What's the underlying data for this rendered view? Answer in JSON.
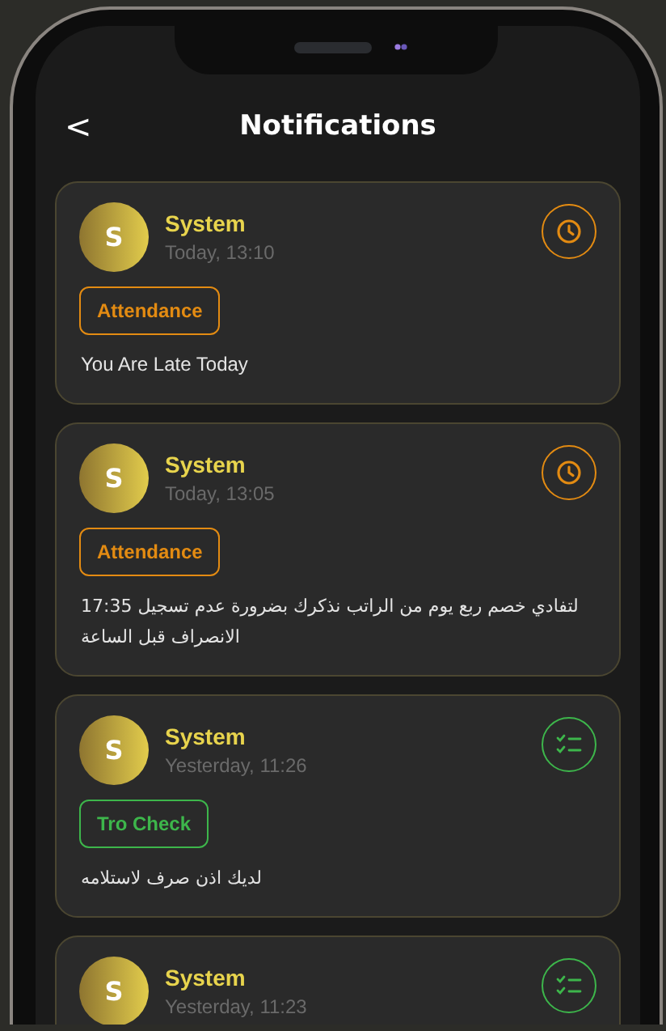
{
  "header": {
    "back": "<",
    "title": "Notifications"
  },
  "notifications": [
    {
      "avatar": "S",
      "sender": "System",
      "time": "Today, 13:10",
      "kind": "attendance",
      "tag": "Attendance",
      "message": "You Are Late Today",
      "rtl": false
    },
    {
      "avatar": "S",
      "sender": "System",
      "time": "Today, 13:05",
      "kind": "attendance",
      "tag": "Attendance",
      "message": "لتفادي خصم ربع يوم من الراتب  نذكرك بضرورة عدم تسجيل 17:35 الانصراف قبل الساعة",
      "rtl": true
    },
    {
      "avatar": "S",
      "sender": "System",
      "time": "Yesterday, 11:26",
      "kind": "tro-check",
      "tag": "Tro Check",
      "message": "لديك اذن صرف لاستلامه",
      "rtl": true
    },
    {
      "avatar": "S",
      "sender": "System",
      "time": "Yesterday, 11:23",
      "kind": "tro-check"
    }
  ]
}
